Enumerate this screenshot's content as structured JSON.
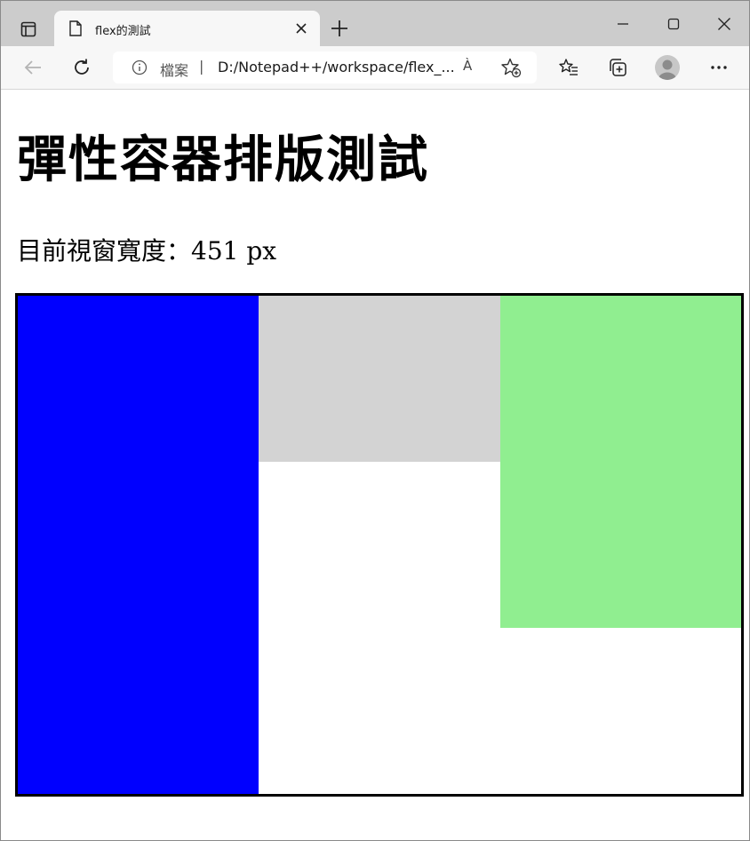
{
  "browser": {
    "tab": {
      "title": "flex的測試"
    },
    "address_bar": {
      "scheme_label": "檔案",
      "separator": "|",
      "url": "D:/Notepad++/workspace/flex_...",
      "read_aloud_label": "À"
    }
  },
  "page": {
    "title": "彈性容器排版測試",
    "viewport_width_text": "目前視窗寬度：451 px"
  },
  "flex_items": [
    {
      "name": "item-1",
      "color": "#0000ff",
      "relative_height": 1.0
    },
    {
      "name": "item-2",
      "color": "#d3d3d3",
      "relative_height": 0.3333
    },
    {
      "name": "item-3",
      "color": "#90ee90",
      "relative_height": 0.6667
    }
  ]
}
